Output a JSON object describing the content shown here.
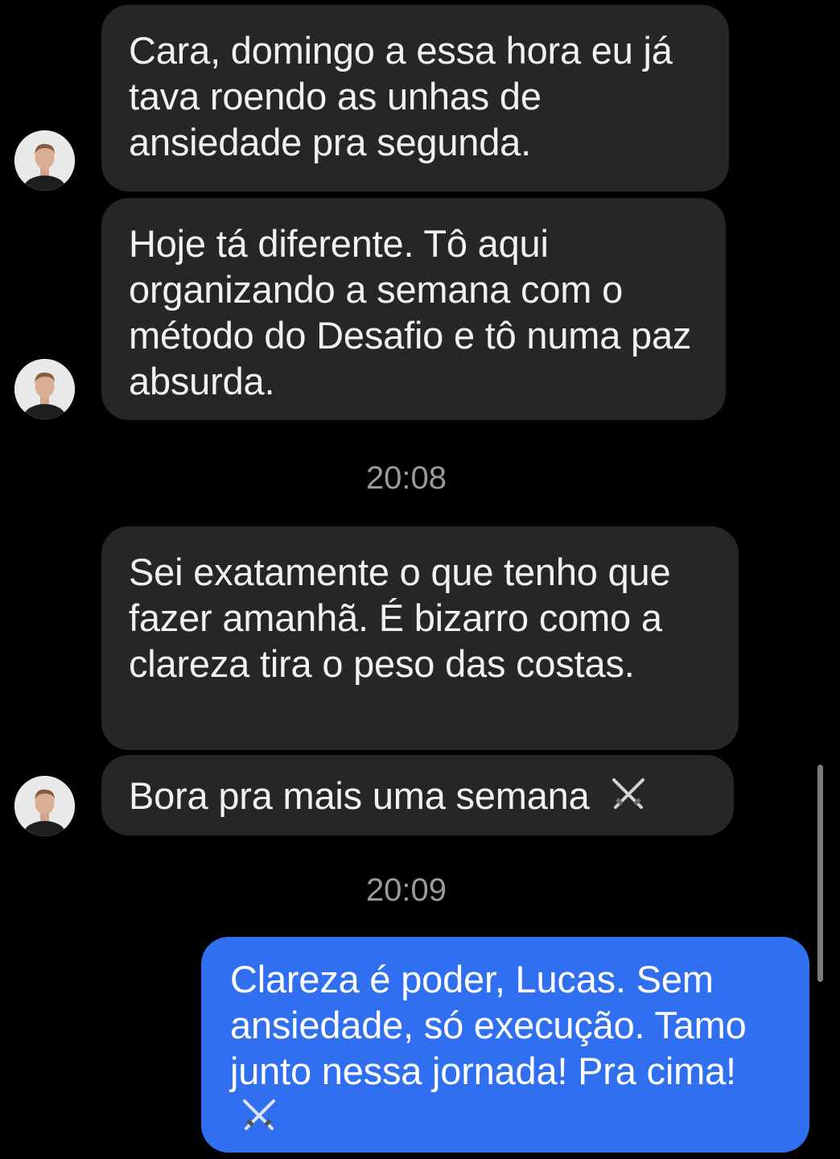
{
  "messages": {
    "m1": "Cara, domingo a essa hora eu já tava roendo as unhas de ansiedade pra segunda.",
    "m2": "Hoje tá diferente. Tô aqui organizando a semana com o método do Desafio e tô numa paz absurda.",
    "m3": "Sei exatamente o que tenho que fazer amanhã. É bizarro como a clareza tira o peso das costas.",
    "m4": "Bora pra mais uma semana",
    "m5": "Clareza é poder, Lucas. Sem ansiedade, só execução. Tamo junto nessa jornada! Pra cima!"
  },
  "timestamps": {
    "t1": "20:08",
    "t2": "20:09"
  },
  "icons": {
    "emoji": "crossed-swords-icon",
    "avatar": "avatar"
  },
  "colors": {
    "background": "#000000",
    "incoming_bubble": "#262626",
    "outgoing_bubble": "#2f6ff0",
    "timestamp_text": "#9a9a9a"
  }
}
